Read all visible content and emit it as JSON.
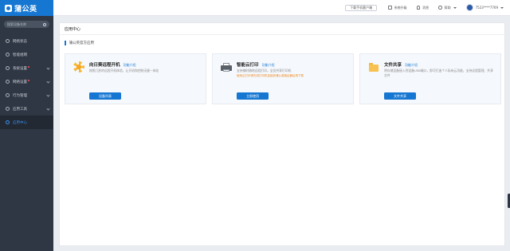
{
  "sidebar": {
    "brand": "蒲公英",
    "search_placeholder": "搜索设备名称",
    "items": [
      {
        "label": "网络状态",
        "badge": false,
        "chevron": false
      },
      {
        "label": "智能组网",
        "badge": false,
        "chevron": false
      },
      {
        "label": "系统设置",
        "badge": true,
        "chevron": true
      },
      {
        "label": "网络设置",
        "badge": true,
        "chevron": true
      },
      {
        "label": "行为管理",
        "badge": false,
        "chevron": true
      },
      {
        "label": "应用工具",
        "badge": false,
        "chevron": true
      },
      {
        "label": "应用中心",
        "badge": false,
        "chevron": false,
        "active": true
      }
    ]
  },
  "topbar": {
    "download_label": "下载手机客户端",
    "upgrade_label": "系统升级",
    "messages_label": "消息",
    "help_label": "帮助",
    "user_label": "7523****7769"
  },
  "main": {
    "title": "应用中心",
    "section_title": "蒲公英官方应用",
    "cards": [
      {
        "title": "向日葵远程开机",
        "link": "功能介绍",
        "desc": "按照几秒的远程开机体验，让开机和控制无缝一体化",
        "warn": "",
        "button": "设备列表"
      },
      {
        "title": "智能云打印",
        "link": "功能介绍",
        "desc": "支持随时随地远程打印，全员共享打印机",
        "warn": "使用云打印请先将打印机连接到蒲公英路由器后再下载",
        "button": "立即使用"
      },
      {
        "title": "文件共享",
        "link": "功能介绍",
        "desc": "将存储设备接入到设备USB端口，即可打造个人私有云功能，支持远程管理、共享文件",
        "warn": "",
        "button": "文件共享"
      }
    ]
  },
  "colors": {
    "sidebar_bg": "#2f3744",
    "brand_blue": "#1677d2",
    "warning_orange": "#f08a24"
  },
  "icons": [
    "search-icon",
    "sun-icon",
    "printer-icon",
    "folder-icon",
    "bell-icon",
    "help-icon",
    "upgrade-icon"
  ]
}
